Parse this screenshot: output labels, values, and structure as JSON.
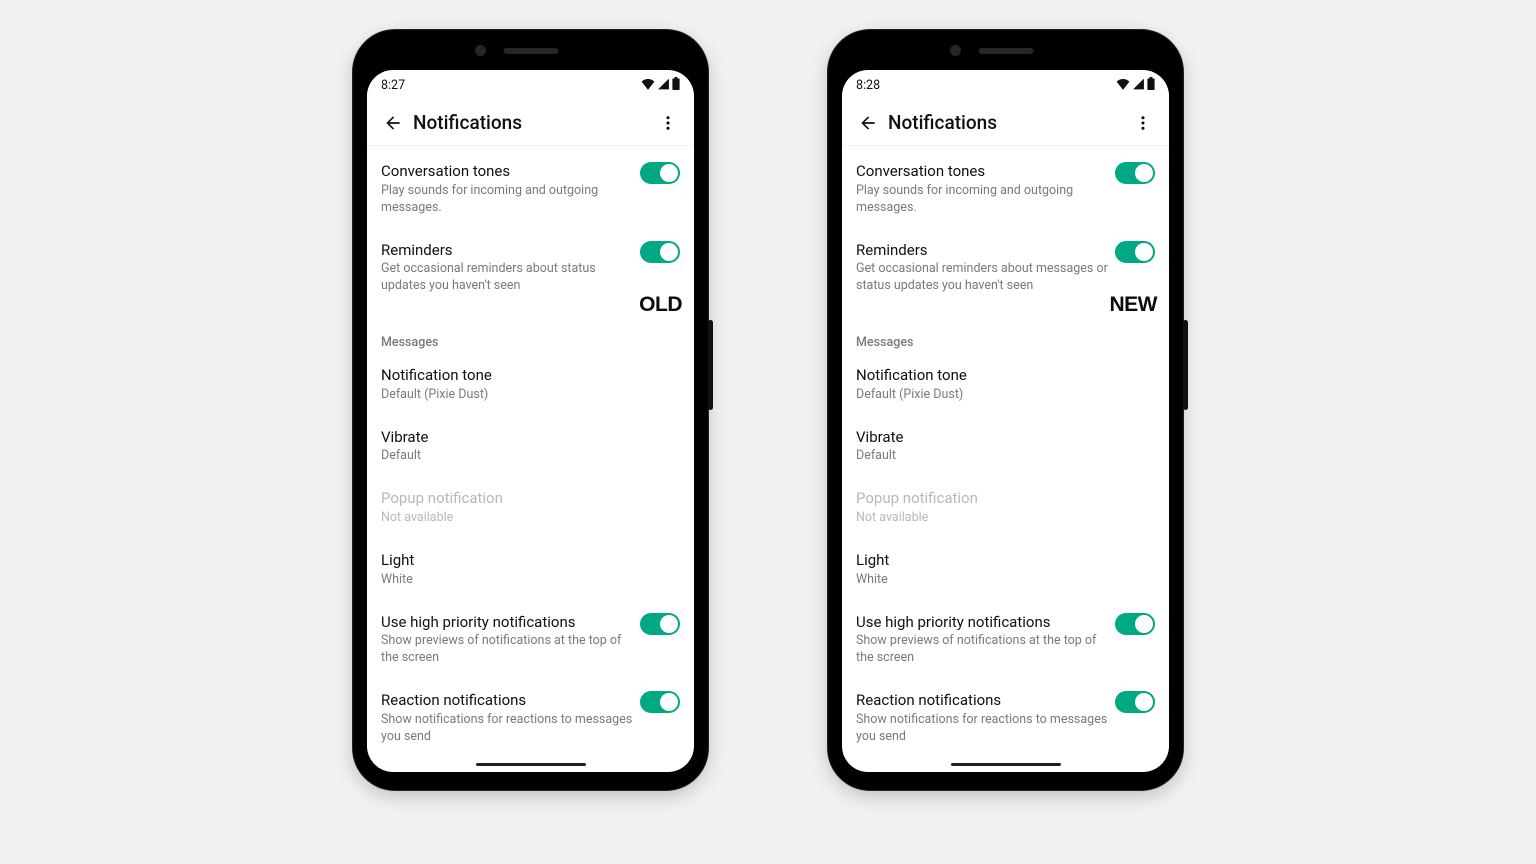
{
  "phones": [
    {
      "key": "old",
      "badge": "OLD",
      "status": {
        "time": "8:27"
      },
      "header": {
        "title": "Notifications"
      },
      "settings": {
        "conversation_tones": {
          "title": "Conversation tones",
          "sub": "Play sounds for incoming and outgoing messages.",
          "on": true
        },
        "reminders": {
          "title": "Reminders",
          "sub": "Get occasional reminders about status updates you haven't seen",
          "on": true
        },
        "section_label": "Messages",
        "notification_tone": {
          "title": "Notification tone",
          "sub": "Default (Pixie Dust)"
        },
        "vibrate": {
          "title": "Vibrate",
          "sub": "Default"
        },
        "popup": {
          "title": "Popup notification",
          "sub": "Not available"
        },
        "light": {
          "title": "Light",
          "sub": "White"
        },
        "high_priority": {
          "title": "Use high priority notifications",
          "sub": "Show previews of notifications at the top of the screen",
          "on": true
        },
        "reaction": {
          "title": "Reaction notifications",
          "sub": "Show notifications for reactions to messages you send",
          "on": true
        }
      }
    },
    {
      "key": "new",
      "badge": "NEW",
      "status": {
        "time": "8:28"
      },
      "header": {
        "title": "Notifications"
      },
      "settings": {
        "conversation_tones": {
          "title": "Conversation tones",
          "sub": "Play sounds for incoming and outgoing messages.",
          "on": true
        },
        "reminders": {
          "title": "Reminders",
          "sub": "Get occasional reminders about messages or status updates you haven't seen",
          "on": true
        },
        "section_label": "Messages",
        "notification_tone": {
          "title": "Notification tone",
          "sub": "Default (Pixie Dust)"
        },
        "vibrate": {
          "title": "Vibrate",
          "sub": "Default"
        },
        "popup": {
          "title": "Popup notification",
          "sub": "Not available"
        },
        "light": {
          "title": "Light",
          "sub": "White"
        },
        "high_priority": {
          "title": "Use high priority notifications",
          "sub": "Show previews of notifications at the top of the screen",
          "on": true
        },
        "reaction": {
          "title": "Reaction notifications",
          "sub": "Show notifications for reactions to messages you send",
          "on": true
        }
      }
    }
  ],
  "colors": {
    "accent": "#00a884"
  }
}
